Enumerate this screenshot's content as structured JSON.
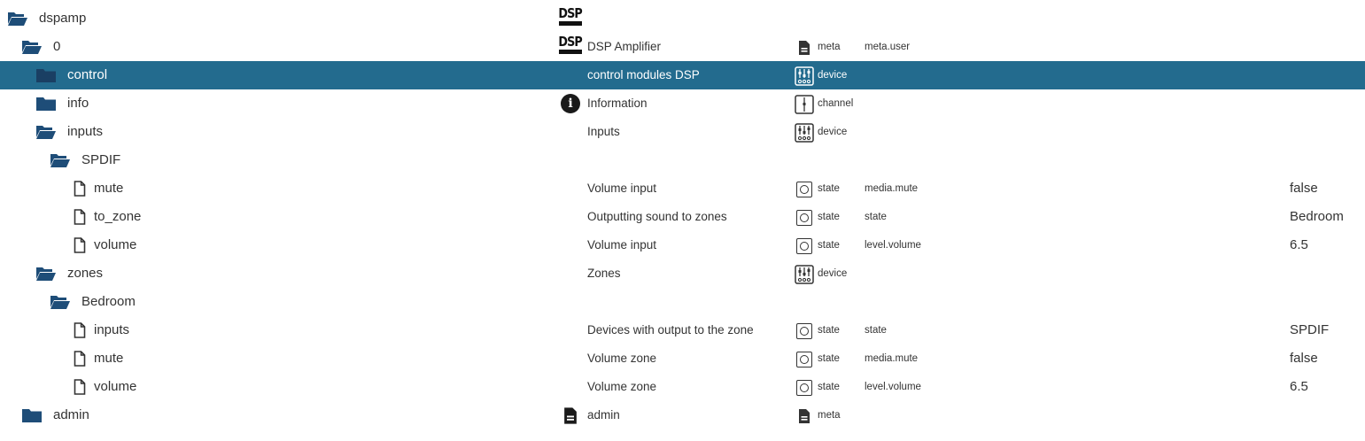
{
  "rows": [
    {
      "name": "dspamp",
      "level": 0,
      "icon": "folder-open-icon",
      "content": "",
      "content_icon": "dsp-logo-icon",
      "type": "",
      "type_icon": "",
      "role": "",
      "value": "",
      "selected": false
    },
    {
      "name": "0",
      "level": 1,
      "icon": "folder-open-icon",
      "content": "DSP Amplifier",
      "content_icon": "dsp-logo-icon",
      "type": "meta",
      "type_icon": "document-icon",
      "role": "meta.user",
      "value": "",
      "selected": false
    },
    {
      "name": "control",
      "level": 2,
      "icon": "folder-closed-icon",
      "content": "control modules DSP",
      "content_icon": "",
      "type": "device",
      "type_icon": "device-icon",
      "role": "",
      "value": "",
      "selected": true
    },
    {
      "name": "info",
      "level": 2,
      "icon": "folder-closed-icon",
      "content": "Information",
      "content_icon": "info-icon",
      "type": "channel",
      "type_icon": "channel-icon",
      "role": "",
      "value": "",
      "selected": false
    },
    {
      "name": "inputs",
      "level": 2,
      "icon": "folder-open-icon",
      "content": "Inputs",
      "content_icon": "",
      "type": "device",
      "type_icon": "device-icon",
      "role": "",
      "value": "",
      "selected": false
    },
    {
      "name": "SPDIF",
      "level": 3,
      "icon": "folder-open-icon",
      "content": "",
      "content_icon": "",
      "type": "",
      "type_icon": "",
      "role": "",
      "value": "",
      "selected": false
    },
    {
      "name": "mute",
      "level": 4,
      "icon": "file-icon",
      "content": "Volume input",
      "content_icon": "",
      "type": "state",
      "type_icon": "state-icon",
      "role": "media.mute",
      "value": "false",
      "selected": false
    },
    {
      "name": "to_zone",
      "level": 4,
      "icon": "file-icon",
      "content": "Outputting sound to zones",
      "content_icon": "",
      "type": "state",
      "type_icon": "state-icon",
      "role": "state",
      "value": "Bedroom",
      "selected": false
    },
    {
      "name": "volume",
      "level": 4,
      "icon": "file-icon",
      "content": "Volume input",
      "content_icon": "",
      "type": "state",
      "type_icon": "state-icon",
      "role": "level.volume",
      "value": "6.5",
      "selected": false
    },
    {
      "name": "zones",
      "level": 2,
      "icon": "folder-open-icon",
      "content": "Zones",
      "content_icon": "",
      "type": "device",
      "type_icon": "device-icon",
      "role": "",
      "value": "",
      "selected": false
    },
    {
      "name": "Bedroom",
      "level": 3,
      "icon": "folder-open-icon",
      "content": "",
      "content_icon": "",
      "type": "",
      "type_icon": "",
      "role": "",
      "value": "",
      "selected": false
    },
    {
      "name": "inputs",
      "level": 4,
      "icon": "file-icon",
      "content": "Devices with output to the zone",
      "content_icon": "",
      "type": "state",
      "type_icon": "state-icon",
      "role": "state",
      "value": "SPDIF",
      "selected": false
    },
    {
      "name": "mute",
      "level": 4,
      "icon": "file-icon",
      "content": "Volume zone",
      "content_icon": "",
      "type": "state",
      "type_icon": "state-icon",
      "role": "media.mute",
      "value": "false",
      "selected": false
    },
    {
      "name": "volume",
      "level": 4,
      "icon": "file-icon",
      "content": "Volume zone",
      "content_icon": "",
      "type": "state",
      "type_icon": "state-icon",
      "role": "level.volume",
      "value": "6.5",
      "selected": false
    },
    {
      "name": "admin",
      "level": 1,
      "icon": "folder-closed-icon",
      "content": "admin",
      "content_icon": "document-icon",
      "type": "meta",
      "type_icon": "document-icon",
      "role": "",
      "value": "",
      "selected": false
    }
  ],
  "colors": {
    "selected_bg": "#236b8e",
    "folder": "#1e4d78",
    "selected_folder": "#1a3f63",
    "text": "#333333",
    "selected_text": "#ffffff"
  }
}
